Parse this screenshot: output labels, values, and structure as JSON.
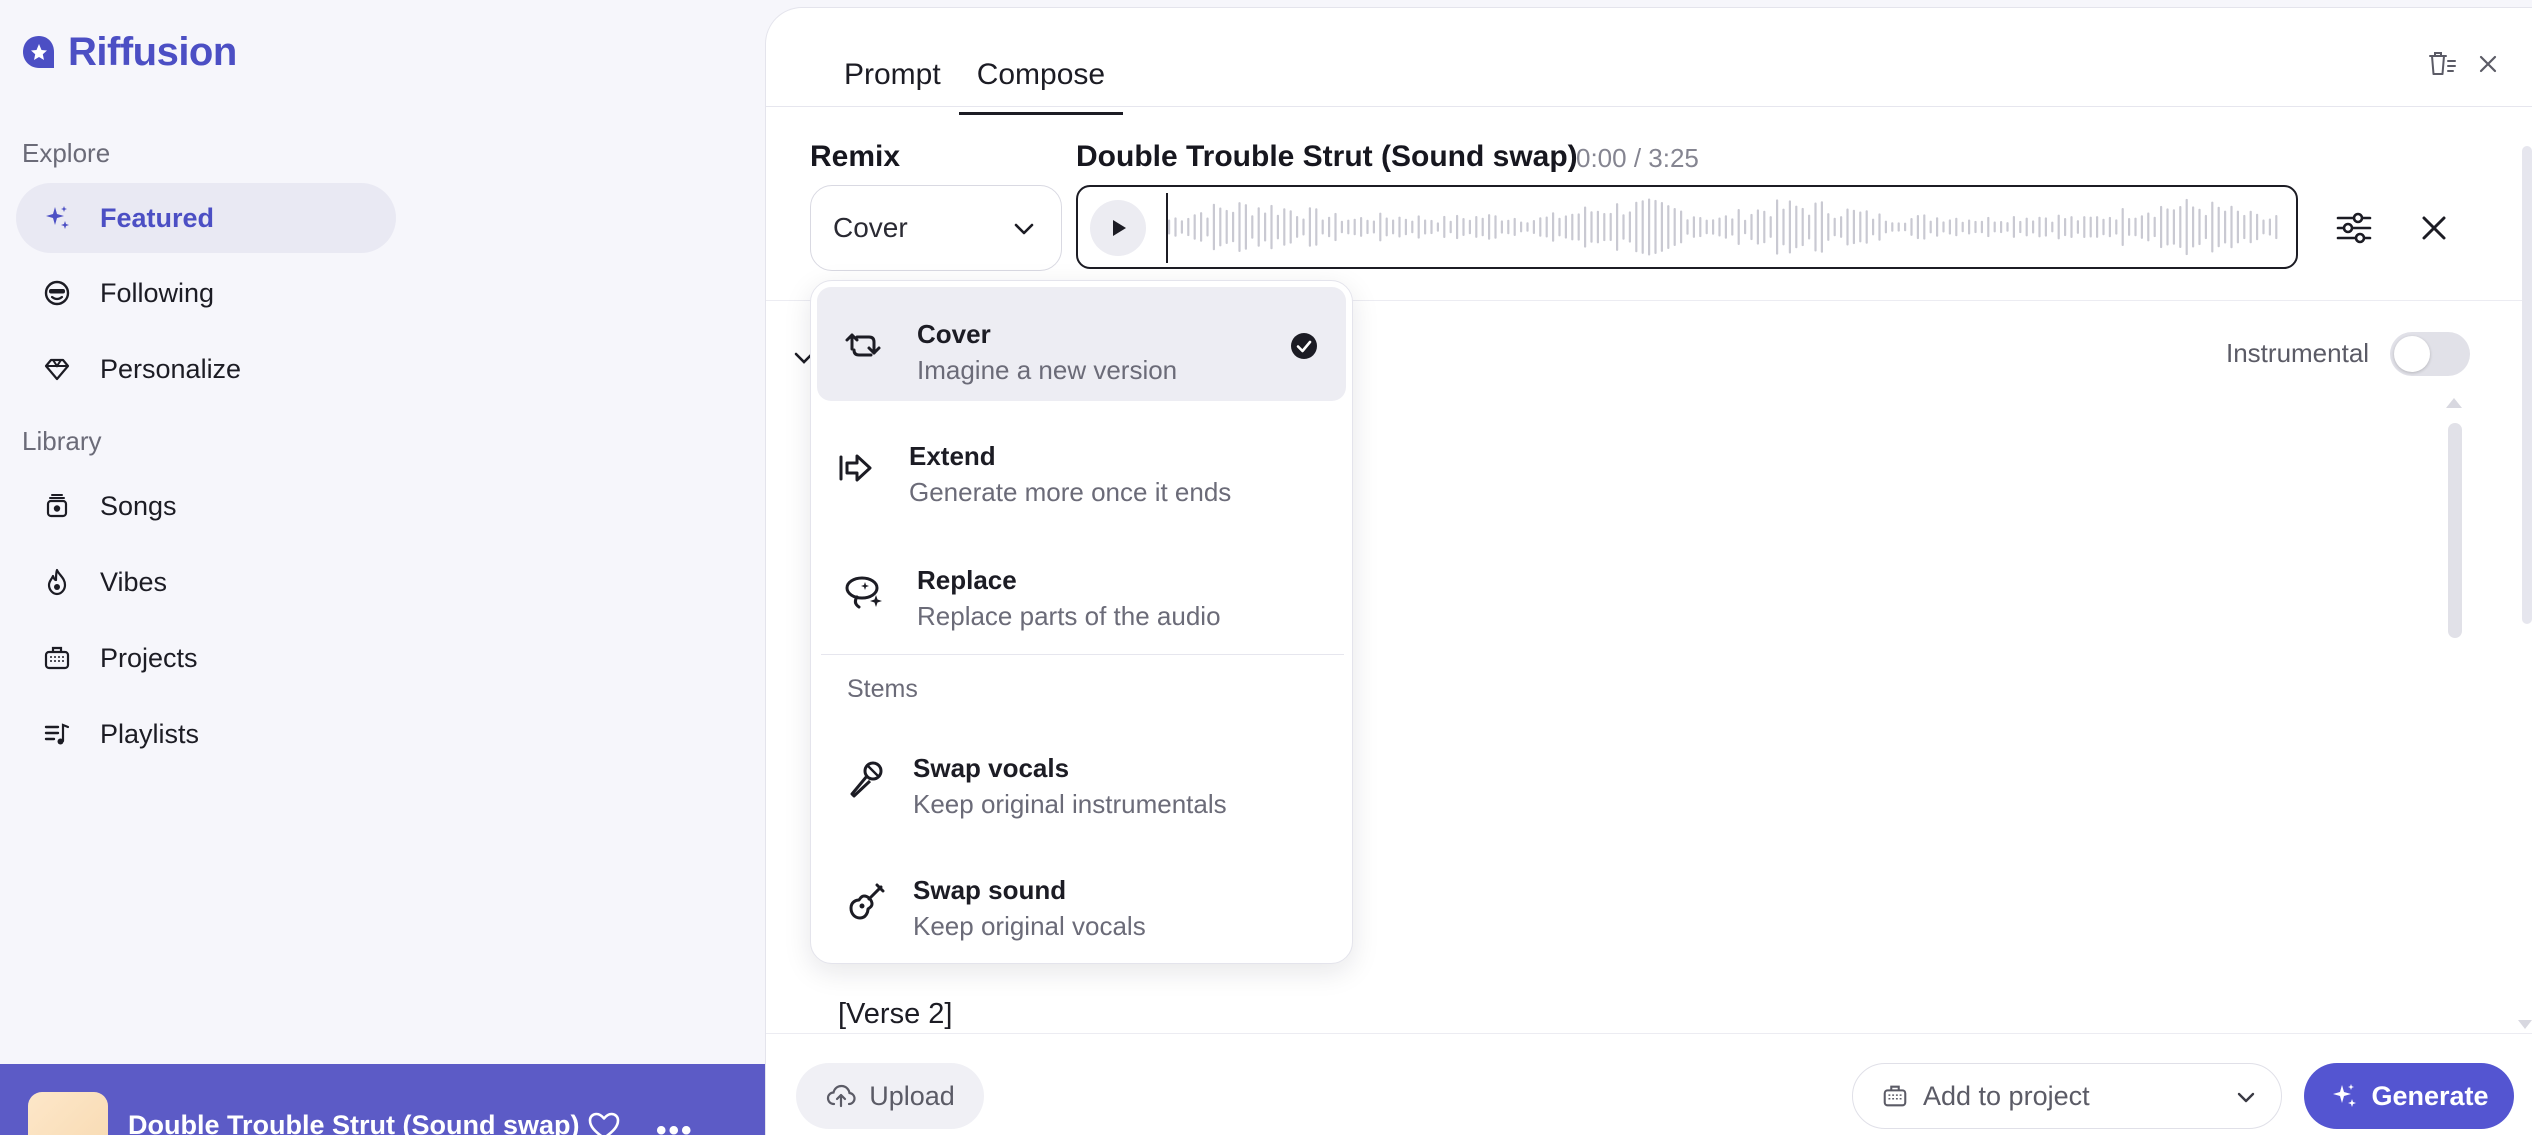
{
  "app": {
    "name": "Riffusion",
    "brand_color": "#4c4fc4"
  },
  "sidebar": {
    "explore_label": "Explore",
    "library_label": "Library",
    "explore_items": [
      {
        "label": "Featured",
        "icon": "sparkles-icon",
        "active": true
      },
      {
        "label": "Following",
        "icon": "smile-sunglasses-icon"
      },
      {
        "label": "Personalize",
        "icon": "diamond-icon"
      }
    ],
    "library_items": [
      {
        "label": "Songs",
        "icon": "songs-stack-icon"
      },
      {
        "label": "Vibes",
        "icon": "flame-icon"
      },
      {
        "label": "Projects",
        "icon": "briefcase-icon"
      },
      {
        "label": "Playlists",
        "icon": "playlist-icon"
      }
    ]
  },
  "player": {
    "title": "Double Trouble Strut (Sound swap)",
    "more_label": "•••"
  },
  "tabs": [
    {
      "label": "Prompt"
    },
    {
      "label": "Compose",
      "active": true
    }
  ],
  "remix": {
    "label": "Remix",
    "selected": "Cover"
  },
  "track": {
    "title": "Double Trouble Strut (Sound swap)",
    "time": "0:00 / 3:25"
  },
  "instrumental": {
    "label": "Instrumental",
    "on": false
  },
  "lyrics": {
    "verse_label": "[Verse 2]"
  },
  "footer": {
    "upload_label": "Upload",
    "project_placeholder": "Add to project",
    "generate_label": "Generate"
  },
  "menu": {
    "items": [
      {
        "title": "Cover",
        "desc": "Imagine a new version",
        "icon": "repeat-arrows-icon",
        "selected": true
      },
      {
        "title": "Extend",
        "desc": "Generate more once it ends",
        "icon": "extend-arrow-icon"
      },
      {
        "title": "Replace",
        "desc": "Replace parts of the audio",
        "icon": "lasso-sparkle-icon"
      }
    ],
    "stems_label": "Stems",
    "stems_items": [
      {
        "title": "Swap vocals",
        "desc": "Keep original instrumentals",
        "icon": "microphone-icon"
      },
      {
        "title": "Swap sound",
        "desc": "Keep original vocals",
        "icon": "guitar-icon"
      }
    ]
  }
}
